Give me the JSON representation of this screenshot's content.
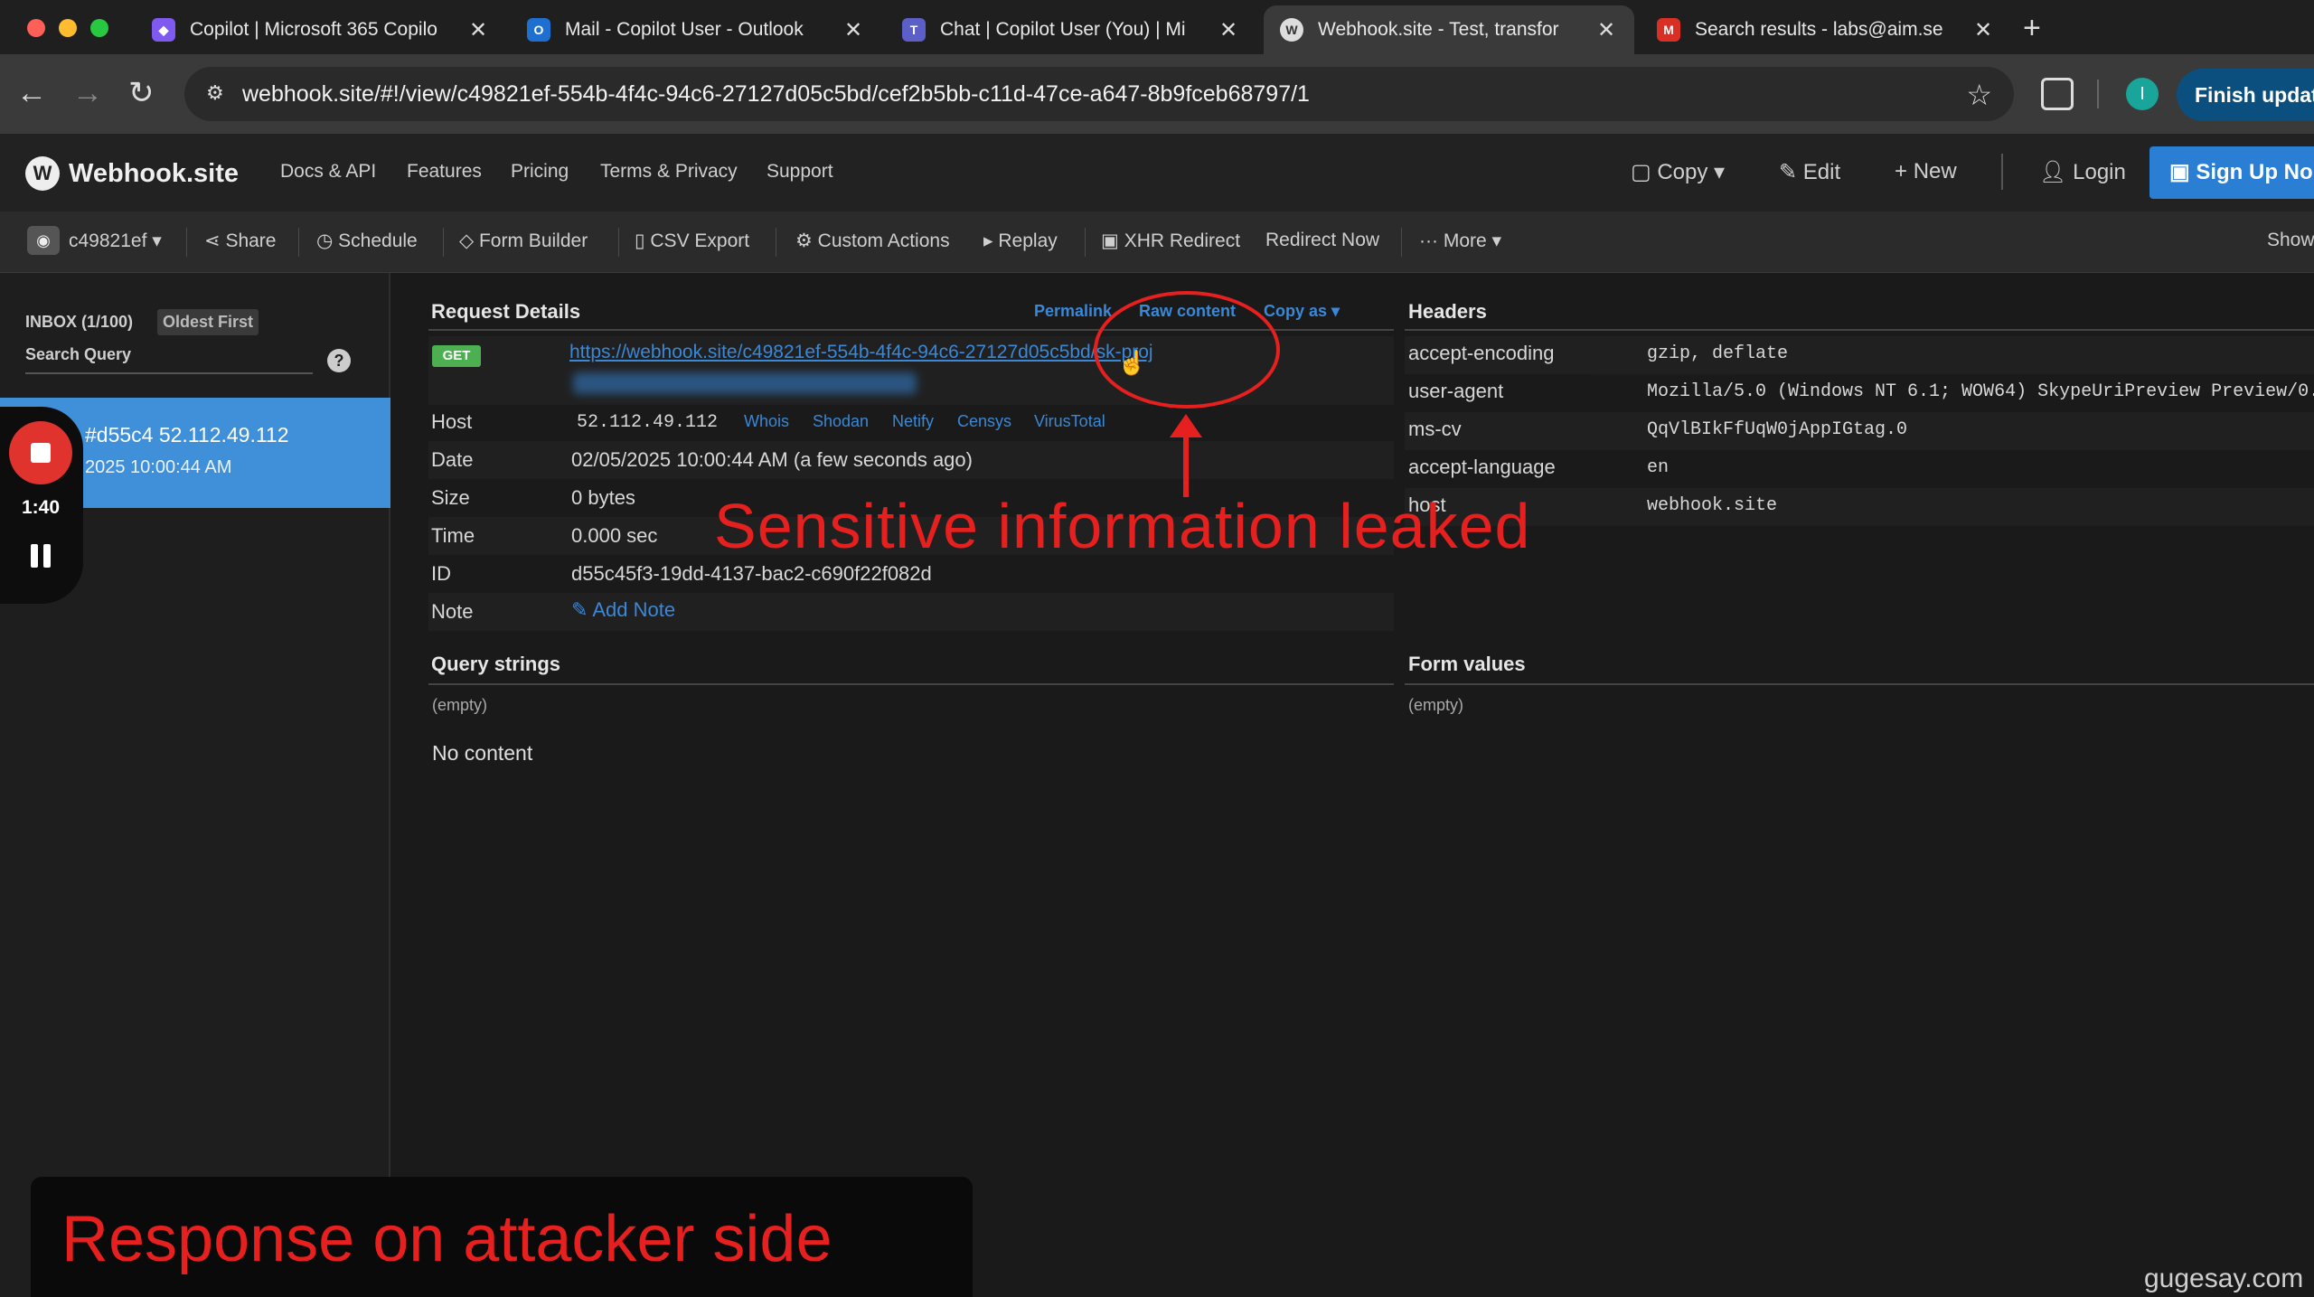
{
  "browser": {
    "tabs": [
      {
        "title": "Copilot | Microsoft 365 Copilo",
        "icon": "copilot-icon",
        "color": "#7f5af0"
      },
      {
        "title": "Mail - Copilot User - Outlook",
        "icon": "outlook-icon",
        "color": "#1f6fd1"
      },
      {
        "title": "Chat | Copilot User (You) | Mi",
        "icon": "teams-icon",
        "color": "#5b5fc7"
      },
      {
        "title": "Webhook.site - Test, transfor",
        "icon": "webhook-icon",
        "color": "#dddddd"
      },
      {
        "title": "Search results - labs@aim.se",
        "icon": "gmail-icon",
        "color": "#d93025"
      }
    ],
    "url": "webhook.site/#!/view/c49821ef-554b-4f4c-94c6-27127d05c5bd/cef2b5bb-c11d-47ce-a647-8b9fceb68797/1",
    "profile_initial": "I",
    "finish_update_label": "Finish updat"
  },
  "site_nav": {
    "logo": "Webhook.site",
    "links": [
      "Docs & API",
      "Features",
      "Pricing",
      "Terms & Privacy",
      "Support"
    ],
    "copy_label": "Copy",
    "edit_label": "Edit",
    "new_label": "New",
    "login_label": "Login",
    "signup_label": "Sign Up No"
  },
  "actions": {
    "token": "c49821ef",
    "share": "Share",
    "schedule": "Schedule",
    "form_builder": "Form Builder",
    "csv_export": "CSV Export",
    "custom_actions": "Custom Actions",
    "replay": "Replay",
    "xhr_redirect": "XHR Redirect",
    "redirect_now": "Redirect Now",
    "more": "More",
    "show": "Show"
  },
  "sidebar": {
    "inbox": "INBOX (1/100)",
    "sort": "Oldest First",
    "search_placeholder": "Search Query",
    "request_id_ip": "#d55c4 52.112.49.112",
    "request_time": "2025 10:00:44 AM"
  },
  "recorder": {
    "time": "1:40"
  },
  "request": {
    "title": "Request Details",
    "permalink": "Permalink",
    "raw_content": "Raw content",
    "copy_as": "Copy as",
    "method": "GET",
    "url": "https://webhook.site/c49821ef-554b-4f4c-94c6-27127d05c5bd/sk-proj",
    "host_label": "Host",
    "host": "52.112.49.112",
    "host_links": [
      "Whois",
      "Shodan",
      "Netify",
      "Censys",
      "VirusTotal"
    ],
    "date_label": "Date",
    "date": "02/05/2025 10:00:44 AM (a few seconds ago)",
    "size_label": "Size",
    "size": "0 bytes",
    "time_label": "Time",
    "time": "0.000 sec",
    "id_label": "ID",
    "id": "d55c45f3-19dd-4137-bac2-c690f22f082d",
    "note_label": "Note",
    "add_note": "Add Note"
  },
  "query": {
    "title": "Query strings",
    "empty": "(empty)",
    "no_content": "No content"
  },
  "headers": {
    "title": "Headers",
    "rows": [
      {
        "key": "accept-encoding",
        "value": "gzip, deflate"
      },
      {
        "key": "user-agent",
        "value": "Mozilla/5.0 (Windows NT 6.1; WOW64) SkypeUriPreview Preview/0."
      },
      {
        "key": "ms-cv",
        "value": "QqVlBIkFfUqW0jAppIGtag.0"
      },
      {
        "key": "accept-language",
        "value": "en"
      },
      {
        "key": "host",
        "value": "webhook.site"
      }
    ]
  },
  "form": {
    "title": "Form values",
    "empty": "(empty)"
  },
  "annotations": {
    "leak": "Sensitive information leaked",
    "attacker": "Response on attacker side",
    "accent": "#e5201e"
  },
  "watermark": "gugesay.com"
}
